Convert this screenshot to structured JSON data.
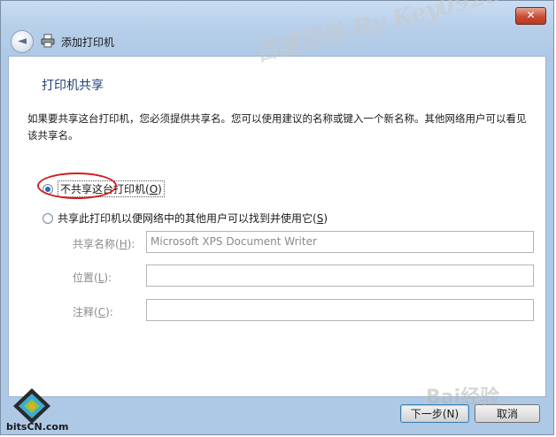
{
  "window": {
    "title": "添加打印机",
    "close_glyph": "✕",
    "back_glyph": "◄"
  },
  "page": {
    "heading": "打印机共享",
    "description": "如果要共享这台打印机，您必须提供共享名。您可以使用建议的名称或键入一个新名称。其他网络用户可以看见该共享名。"
  },
  "options": {
    "no_share": {
      "label_prefix": "不共享这台打印机(",
      "accel": "O",
      "label_suffix": ")",
      "checked": true
    },
    "share": {
      "label_prefix": "共享此打印机以便网络中的其他用户可以找到并使用它(",
      "accel": "S",
      "label_suffix": ")",
      "checked": false
    }
  },
  "fields": {
    "share_name": {
      "label_prefix": "共享名称(",
      "accel": "H",
      "label_suffix": "):",
      "value": "Microsoft XPS Document Writer"
    },
    "location": {
      "label_prefix": "位置(",
      "accel": "L",
      "label_suffix": "):",
      "value": ""
    },
    "comment": {
      "label_prefix": "注释(",
      "accel": "C",
      "label_suffix": "):",
      "value": ""
    }
  },
  "buttons": {
    "next_label": "下一步(N)",
    "cancel_label": "取消"
  },
  "watermarks": {
    "overlay_text": "百度经验 By Key0928",
    "site_logo": "bitsCN.com",
    "baidu_mark": "Bai经验"
  },
  "icons": {
    "title": "printer-icon",
    "back": "back-arrow-icon",
    "close": "close-icon",
    "logo": "bitscn-logo-icon"
  },
  "colors": {
    "heading": "#1e3f7a",
    "highlight_ellipse": "#d01d1d",
    "radio_dot": "#1f6ec0"
  }
}
